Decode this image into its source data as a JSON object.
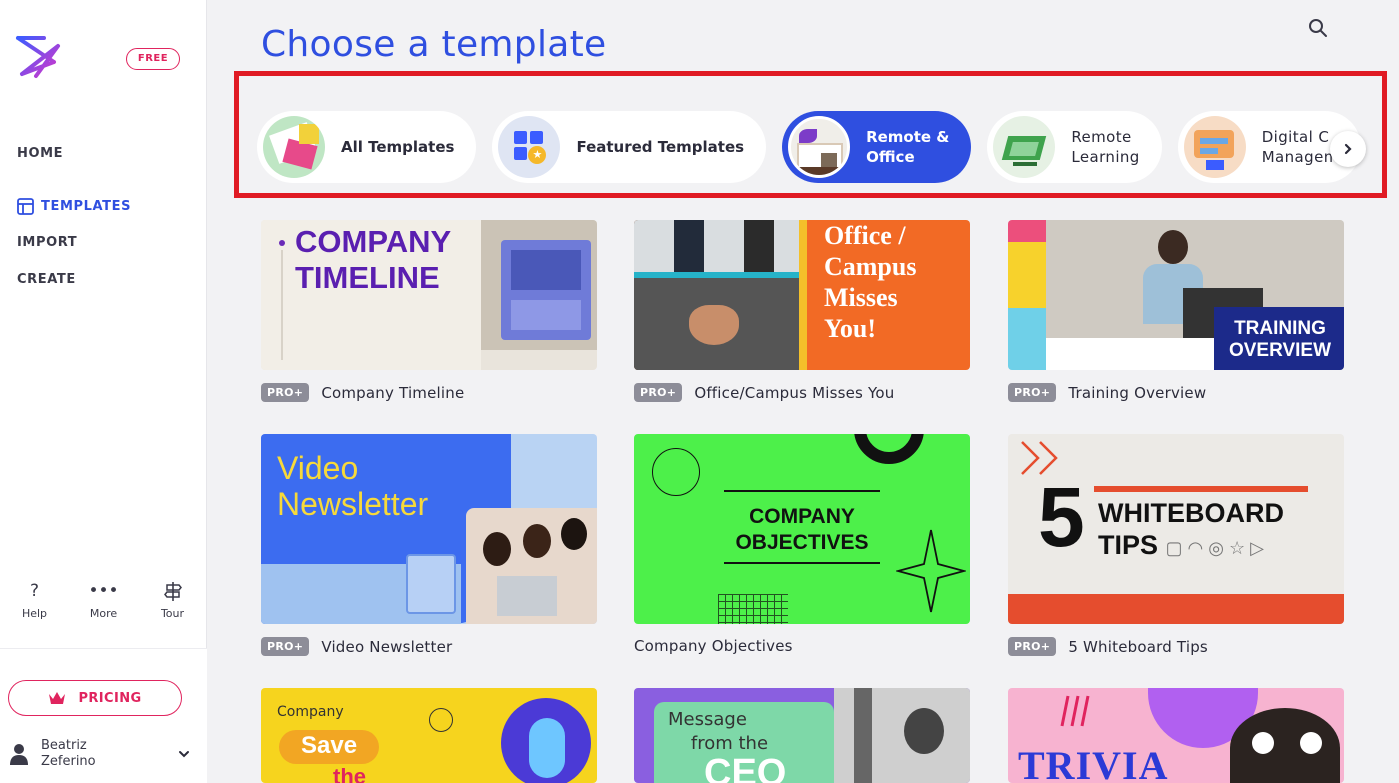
{
  "sidebar": {
    "free_badge": "FREE",
    "nav": {
      "home": "HOME",
      "templates": "TEMPLATES",
      "import": "IMPORT",
      "create": "CREATE"
    },
    "helpers": {
      "help": "Help",
      "more": "More",
      "tour": "Tour"
    },
    "pricing": "PRICING",
    "user": {
      "first_name": "Beatriz",
      "last_name": "Zeferino"
    }
  },
  "main": {
    "title": "Choose a template",
    "categories": [
      {
        "line1": "All Templates",
        "line2": ""
      },
      {
        "line1": "Featured Templates",
        "line2": ""
      },
      {
        "line1": "Remote &",
        "line2": "Office"
      },
      {
        "line1": "Remote",
        "line2": "Learning"
      },
      {
        "line1": "Digital C",
        "line2": "Managem"
      }
    ],
    "templates": [
      {
        "title": "Company Timeline",
        "badge": "PRO+",
        "thumb_text": "COMPANY TIMELINE"
      },
      {
        "title": "Office/Campus Misses You",
        "badge": "PRO+",
        "thumb_text": "Office / Campus Misses You!"
      },
      {
        "title": "Training Overview",
        "badge": "PRO+",
        "thumb_text": "TRAINING OVERVIEW"
      },
      {
        "title": "Video Newsletter",
        "badge": "PRO+",
        "thumb_text": "Video Newsletter"
      },
      {
        "title": "Company Objectives",
        "badge": "",
        "thumb_text": "COMPANY OBJECTIVES"
      },
      {
        "title": "5 Whiteboard Tips",
        "badge": "PRO+",
        "thumb_text": "WHITEBOARD TIPS"
      },
      {
        "title": "",
        "badge": "",
        "thumb_text": "Company Save the"
      },
      {
        "title": "",
        "badge": "",
        "thumb_text": "Message from the CEO"
      },
      {
        "title": "",
        "badge": "",
        "thumb_text": "TRIVIA"
      }
    ]
  },
  "colors": {
    "brand_blue": "#2f4fe0",
    "accent_pink": "#e0245e",
    "highlight_red": "#e01b24"
  }
}
